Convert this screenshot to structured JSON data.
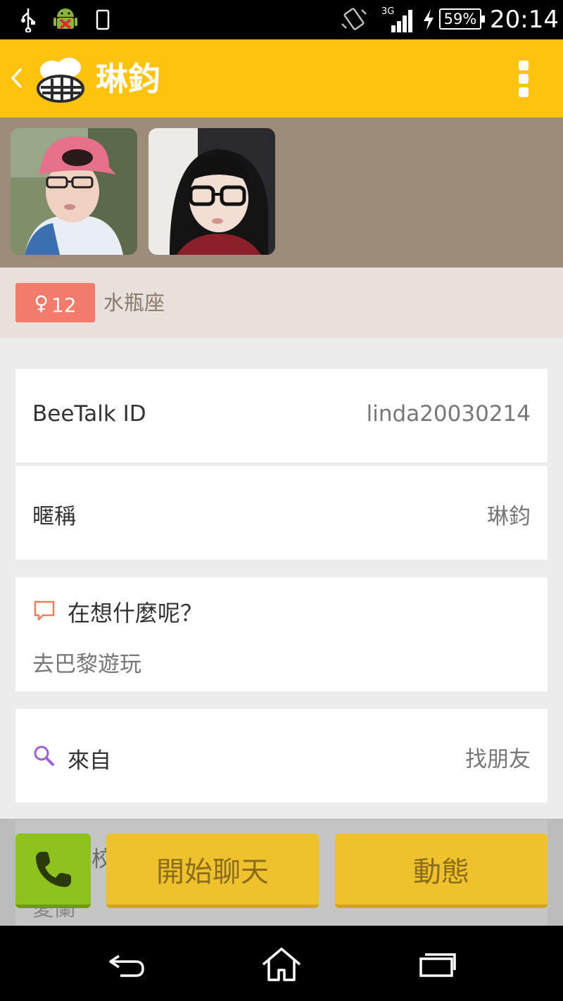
{
  "status_bar": {
    "battery": "59%",
    "network": "3G",
    "time": "20:14"
  },
  "app_bar": {
    "title": "琳鈞"
  },
  "profile": {
    "age": "12",
    "gender_symbol": "♀",
    "zodiac": "水瓶座"
  },
  "details": {
    "id_label": "BeeTalk ID",
    "id_value": "linda20030214",
    "nickname_label": "暱稱",
    "nickname_value": "琳鈞",
    "status_label": "在想什麼呢？",
    "status_value": "去巴黎遊玩",
    "from_label": "來自",
    "from_value": "找朋友"
  },
  "partial_card": {
    "label_fragment": "校",
    "value_fragment": "愛蘭"
  },
  "actions": {
    "chat_label": "開始聊天",
    "moments_label": "動態"
  },
  "colors": {
    "app_bar": "#fec30f",
    "photo_strip": "#9e8c7a",
    "gender_badge": "#f27b6b",
    "call_button": "#8ec21f",
    "action_button": "#efc12c"
  }
}
